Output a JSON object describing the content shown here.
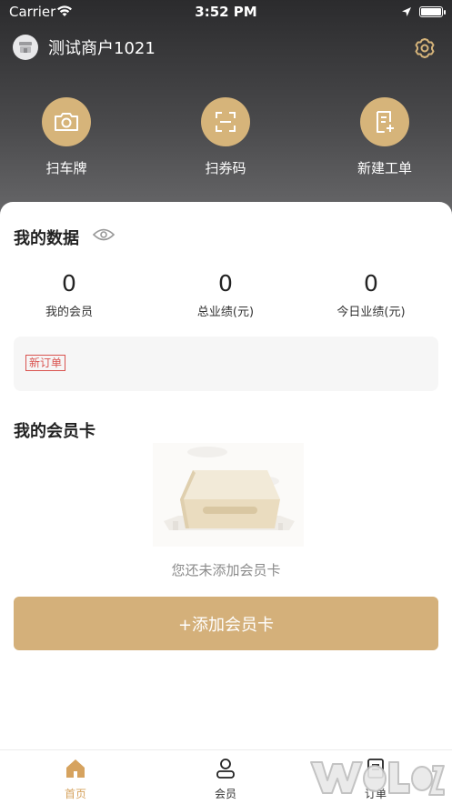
{
  "status_bar": {
    "carrier": "Carrier",
    "time": "3:52 PM"
  },
  "header": {
    "merchant_name": "测试商户1021",
    "icons": {
      "avatar": "store-icon",
      "settings": "gear-icon"
    },
    "actions": [
      {
        "label": "扫车牌",
        "icon": "camera-icon"
      },
      {
        "label": "扫券码",
        "icon": "scan-icon"
      },
      {
        "label": "新建工单",
        "icon": "new-document-icon"
      }
    ],
    "accent_color": "#d6b47a"
  },
  "my_data": {
    "title": "我的数据",
    "stats": [
      {
        "value": "0",
        "label": "我的会员"
      },
      {
        "value": "0",
        "label": "总业绩(元)"
      },
      {
        "value": "0",
        "label": "今日业绩(元)"
      }
    ],
    "new_order_tag": "新订单"
  },
  "member_cards": {
    "title": "我的会员卡",
    "empty_text": "您还未添加会员卡",
    "add_button": "+添加会员卡",
    "button_color": "#d4b07a"
  },
  "tabbar": {
    "items": [
      {
        "label": "首页",
        "icon": "home-icon",
        "active": true
      },
      {
        "label": "会员",
        "icon": "user-icon",
        "active": false
      },
      {
        "label": "订单",
        "icon": "order-icon",
        "active": false
      }
    ],
    "active_color": "#d6a35f"
  }
}
